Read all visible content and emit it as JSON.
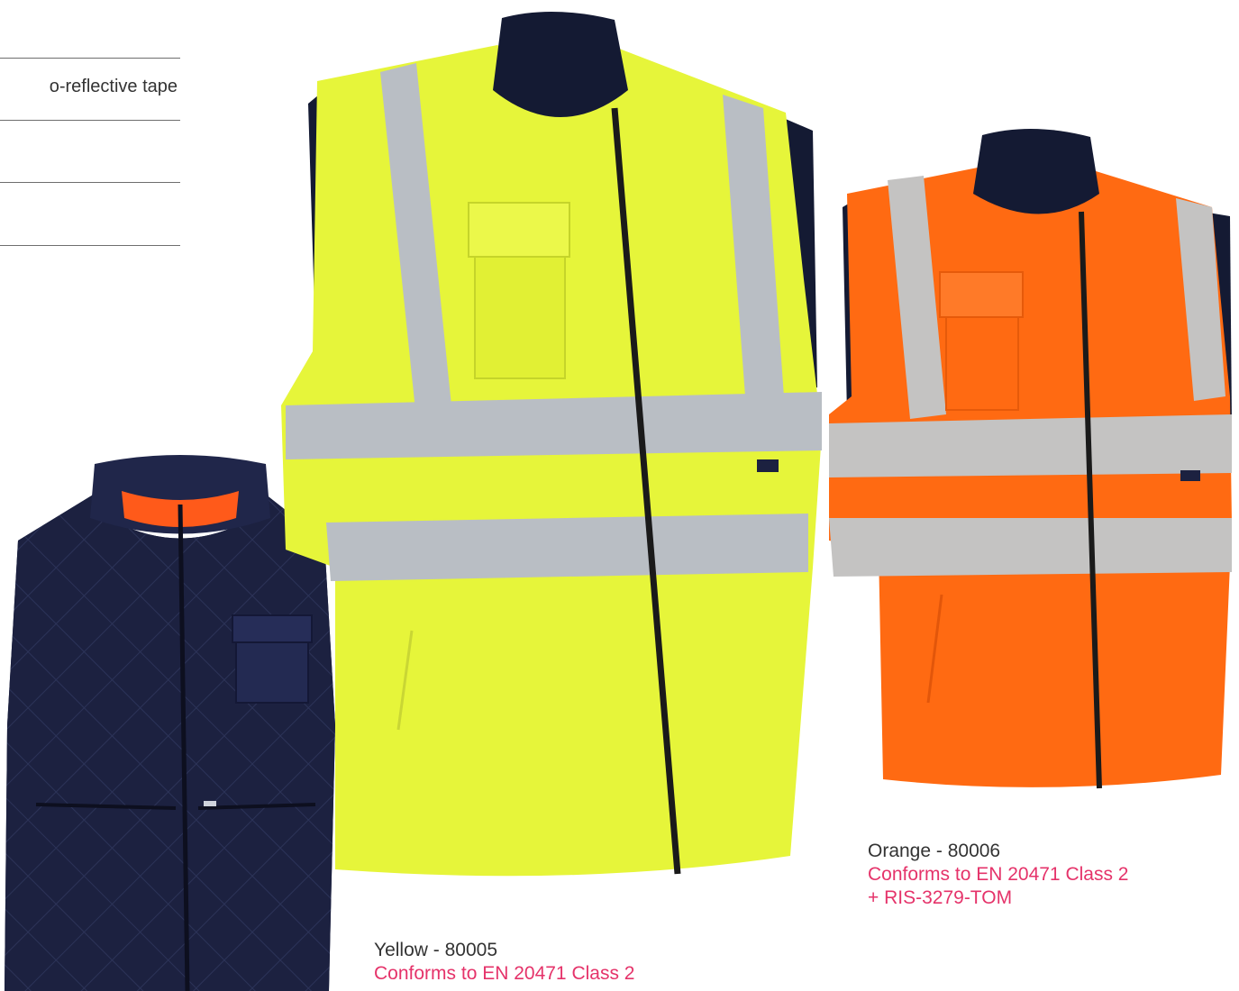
{
  "features": [
    {
      "text": "o-reflective tape"
    },
    {
      "text": ""
    },
    {
      "text": ""
    }
  ],
  "products": [
    {
      "color_name": "Navy",
      "garment": "quilted-reversible-vest",
      "body_color": "#1c2140",
      "accent_color": "#ff5a1a"
    },
    {
      "label": "Yellow - 80005",
      "spec_lines": [
        "Conforms to EN 20471 Class 2"
      ],
      "body_color": "#e6f53a",
      "tape_color": "#b9bec4",
      "collar_color": "#141a33"
    },
    {
      "label": "Orange - 80006",
      "spec_lines": [
        "Conforms to EN 20471 Class 2",
        "+ RIS-3279-TOM"
      ],
      "body_color": "#ff6a12",
      "tape_color": "#c4c3c2",
      "collar_color": "#141a33"
    }
  ],
  "colors": {
    "spec_text": "#e5336a",
    "body_text": "#333333",
    "rule": "#6e6e6e"
  }
}
